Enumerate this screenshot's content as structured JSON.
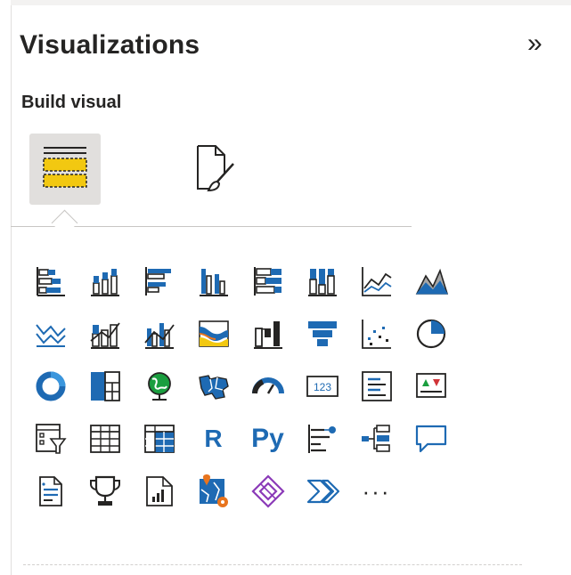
{
  "pane": {
    "title": "Visualizations",
    "subtitle": "Build visual",
    "collapse_glyph": "»"
  },
  "tabs": [
    {
      "icon": "fields-icon",
      "active": true
    },
    {
      "icon": "format-visual-icon",
      "active": false
    }
  ],
  "visuals": [
    {
      "name": "stacked-bar-chart-icon"
    },
    {
      "name": "stacked-column-chart-icon"
    },
    {
      "name": "clustered-bar-chart-icon"
    },
    {
      "name": "clustered-column-chart-icon"
    },
    {
      "name": "100-stacked-bar-chart-icon"
    },
    {
      "name": "100-stacked-column-chart-icon"
    },
    {
      "name": "line-chart-icon"
    },
    {
      "name": "area-chart-icon"
    },
    {
      "name": "stacked-area-chart-icon"
    },
    {
      "name": "line-and-stacked-column-chart-icon"
    },
    {
      "name": "line-and-clustered-column-chart-icon"
    },
    {
      "name": "ribbon-chart-icon"
    },
    {
      "name": "waterfall-chart-icon"
    },
    {
      "name": "funnel-icon"
    },
    {
      "name": "scatter-chart-icon"
    },
    {
      "name": "pie-chart-icon"
    },
    {
      "name": "donut-chart-icon"
    },
    {
      "name": "treemap-icon"
    },
    {
      "name": "map-icon"
    },
    {
      "name": "filled-map-icon"
    },
    {
      "name": "gauge-icon"
    },
    {
      "name": "card-icon",
      "text": "123"
    },
    {
      "name": "multi-row-card-icon"
    },
    {
      "name": "kpi-icon"
    },
    {
      "name": "slicer-icon"
    },
    {
      "name": "table-icon"
    },
    {
      "name": "matrix-icon"
    },
    {
      "name": "r-script-visual-icon",
      "text": "R"
    },
    {
      "name": "python-visual-icon",
      "text": "Py"
    },
    {
      "name": "key-influencers-icon"
    },
    {
      "name": "decomposition-tree-icon"
    },
    {
      "name": "qa-icon"
    },
    {
      "name": "smart-narrative-icon"
    },
    {
      "name": "metrics-icon"
    },
    {
      "name": "paginated-report-icon"
    },
    {
      "name": "azure-map-icon"
    },
    {
      "name": "power-apps-icon"
    },
    {
      "name": "power-automate-icon"
    },
    {
      "name": "more-visuals-icon",
      "text": "···"
    }
  ],
  "colors": {
    "blue": "#1e6ab3",
    "dark": "#252423",
    "yellow": "#f2c811",
    "orange": "#e8741d",
    "green": "#1a9e3f",
    "red": "#d13438",
    "teal": "#3a96dd"
  }
}
